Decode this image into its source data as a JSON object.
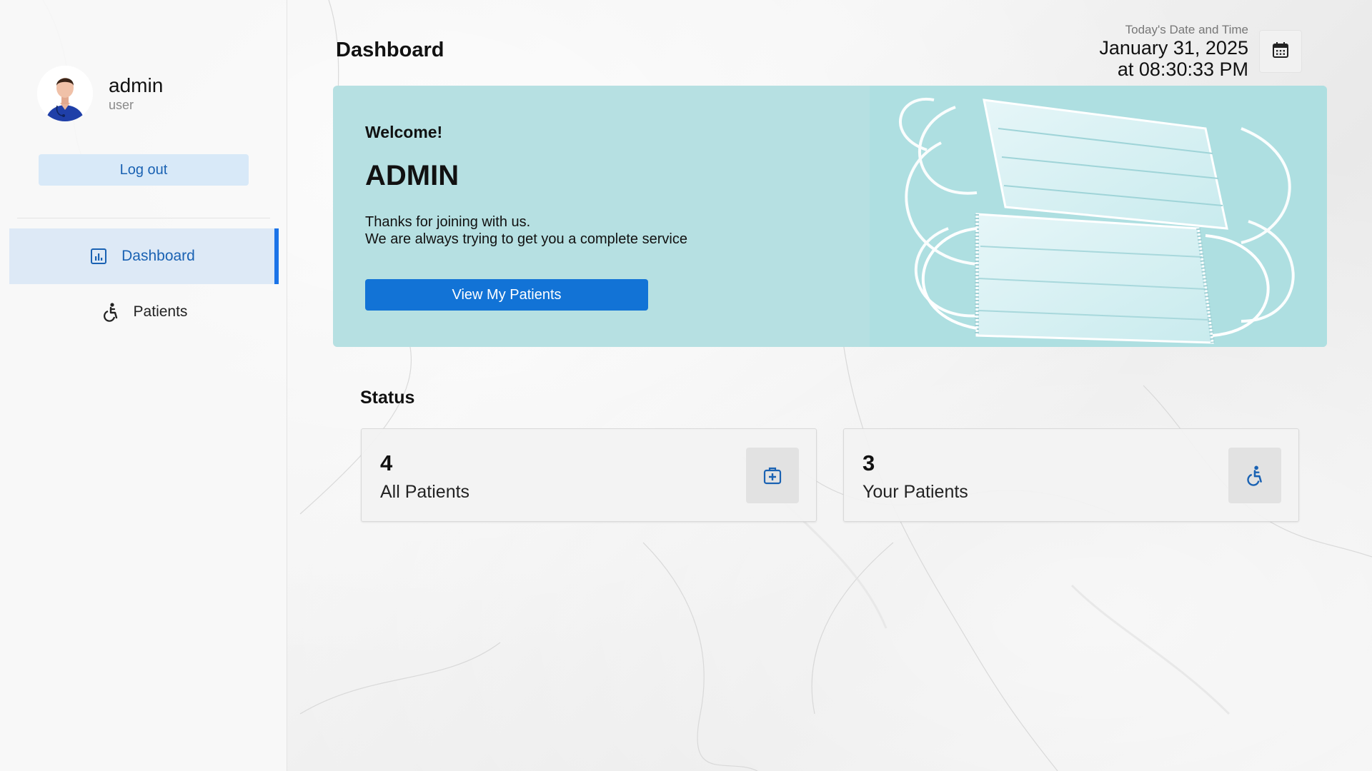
{
  "sidebar": {
    "user": {
      "name": "admin",
      "role": "user"
    },
    "logout_label": "Log out",
    "nav": [
      {
        "label": "Dashboard",
        "icon": "bar-chart-icon",
        "active": true
      },
      {
        "label": "Patients",
        "icon": "accessible-icon",
        "active": false
      }
    ]
  },
  "header": {
    "title": "Dashboard",
    "datetime_caption": "Today's Date and Time",
    "date": "January 31, 2025",
    "time": "at 08:30:33 PM",
    "calendar_icon": "calendar-icon"
  },
  "banner": {
    "welcome": "Welcome!",
    "name": "ADMIN",
    "line1": "Thanks for joining with us.",
    "line2": "We are always trying to get you a complete service",
    "button_label": "View My Patients"
  },
  "status": {
    "title": "Status",
    "cards": [
      {
        "value": "4",
        "label": "All Patients",
        "icon": "medical-kit-icon"
      },
      {
        "value": "3",
        "label": "Your Patients",
        "icon": "accessible-icon"
      }
    ]
  },
  "colors": {
    "accent": "#1273d6",
    "banner": "#b6e0e2",
    "sidebar_active": "#dde9f6"
  }
}
